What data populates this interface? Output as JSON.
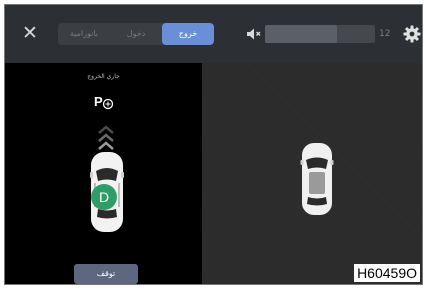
{
  "topbar": {
    "tabs": [
      {
        "label": "بانورامية",
        "active": false
      },
      {
        "label": "دخول",
        "active": false
      },
      {
        "label": "خروج",
        "active": true
      }
    ],
    "volume": {
      "value": "12",
      "level": 0.65
    }
  },
  "left_panel": {
    "status_text": "جاري الخروج",
    "gear": "D",
    "stop_button_label": "توقف"
  },
  "image_code": "H60459O",
  "colors": {
    "tab_active": "#6a8fd9",
    "gear_badge": "#2e9d67",
    "stop_button": "#5d6780"
  }
}
